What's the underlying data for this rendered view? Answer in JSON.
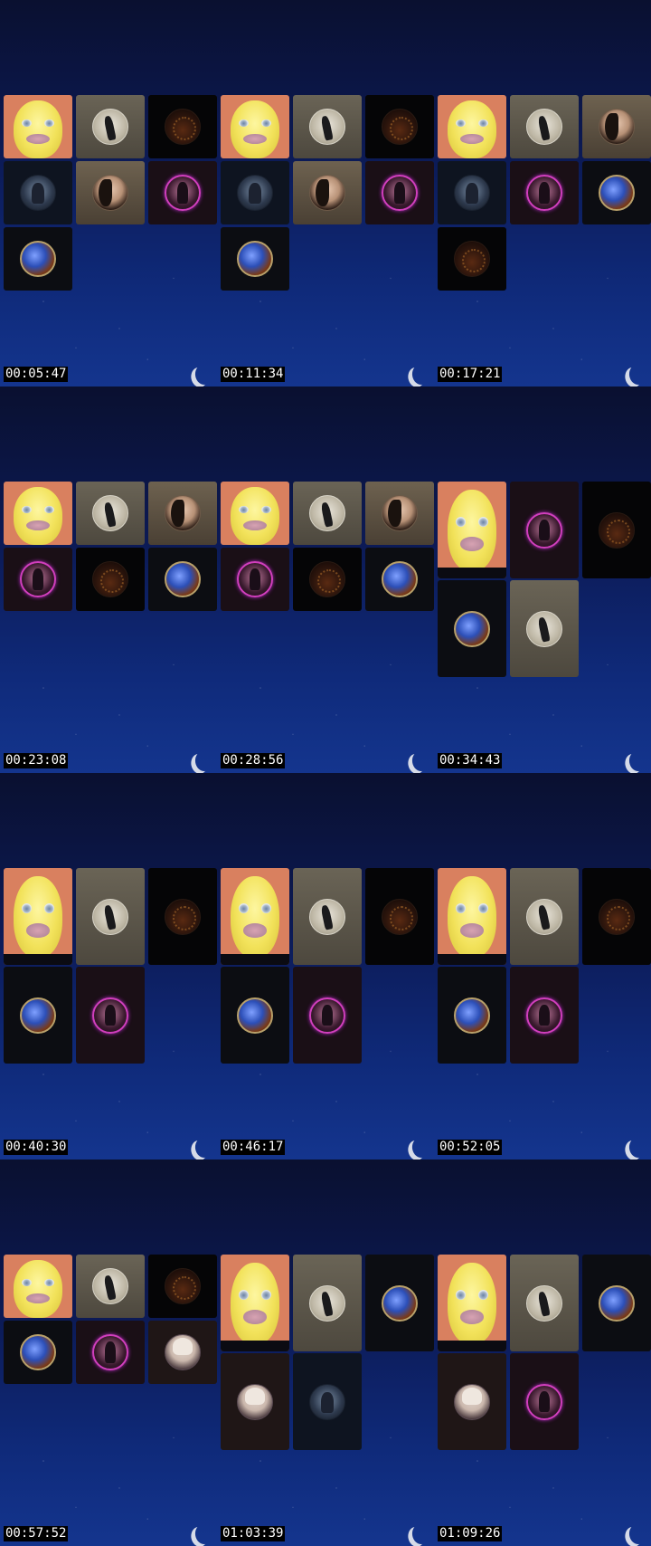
{
  "timestamps": [
    "00:05:47",
    "00:11:34",
    "00:17:21",
    "00:23:08",
    "00:28:56",
    "00:34:43",
    "00:40:30",
    "00:46:17",
    "00:52:05",
    "00:57:52",
    "01:03:39",
    "01:09:26"
  ],
  "icons": {
    "lemon": "lemon-face-avatar",
    "hoodie": "hoodie-person-avatar",
    "arch": "dark-arch-avatar",
    "knight": "armored-knight-avatar",
    "girl": "dark-hair-girl-avatar",
    "ring": "neon-ring-avatar",
    "globe": "fire-ice-globe-avatar",
    "blonde": "blonde-singer-avatar",
    "moon": "crescent-moon-icon"
  },
  "colors": {
    "background_top": "#0a1030",
    "background_bottom": "#14358e",
    "lemon_tile": "#d9805f",
    "neon_ring": "#d13fbd"
  },
  "cells": [
    {
      "layout": "g3",
      "tiles": [
        "lemon",
        "hoodie",
        "arch",
        "knight",
        "girl",
        "ring",
        "globe"
      ]
    },
    {
      "layout": "g3",
      "tiles": [
        "lemon",
        "hoodie",
        "arch",
        "knight",
        "girl",
        "ring",
        "globe"
      ]
    },
    {
      "layout": "g3",
      "tiles": [
        "lemon",
        "hoodie",
        "girl",
        "knight",
        "ring",
        "globe",
        "arch"
      ]
    },
    {
      "layout": "g3",
      "tiles": [
        "lemon",
        "hoodie",
        "girl",
        "ring",
        "arch",
        "globe"
      ]
    },
    {
      "layout": "g3",
      "tiles": [
        "lemon",
        "hoodie",
        "girl",
        "ring",
        "arch",
        "globe"
      ]
    },
    {
      "layout": "tall",
      "tiles": [
        "lemon",
        "ring",
        "arch",
        "globe",
        "hoodie"
      ]
    },
    {
      "layout": "tall",
      "tiles": [
        "lemon",
        "hoodie",
        "arch",
        "globe",
        "ring"
      ]
    },
    {
      "layout": "tall",
      "tiles": [
        "lemon",
        "hoodie",
        "arch",
        "globe",
        "ring"
      ]
    },
    {
      "layout": "tall",
      "tiles": [
        "lemon",
        "hoodie",
        "arch",
        "globe",
        "ring"
      ]
    },
    {
      "layout": "g3",
      "tiles": [
        "lemon",
        "hoodie",
        "arch",
        "globe",
        "ring",
        "blonde"
      ]
    },
    {
      "layout": "tall",
      "tiles": [
        "lemon",
        "hoodie",
        "globe",
        "blonde",
        "knight"
      ]
    },
    {
      "layout": "tall",
      "tiles": [
        "lemon",
        "hoodie",
        "globe",
        "blonde",
        "ring"
      ]
    }
  ]
}
